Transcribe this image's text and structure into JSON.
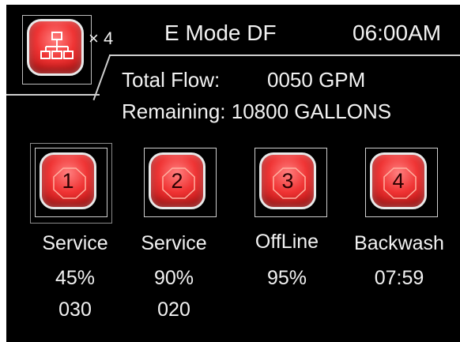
{
  "header": {
    "multiplier": "× 4",
    "mode": "E Mode DF",
    "time": "06:00AM"
  },
  "info": {
    "total_flow_label": "Total Flow:",
    "total_flow_value": "0050 GPM",
    "remaining": "Remaining: 10800 GALLONS"
  },
  "valves": [
    {
      "number": "1",
      "status": "Service",
      "line2": "45%",
      "line3": "030"
    },
    {
      "number": "2",
      "status": "Service",
      "line2": "90%",
      "line3": "020"
    },
    {
      "number": "3",
      "status": "OffLine",
      "line2": "95%",
      "line3": ""
    },
    {
      "number": "4",
      "status": "Backwash",
      "line2": "07:59",
      "line3": ""
    }
  ],
  "icons": {
    "hub": "network-tree-icon"
  },
  "colors": {
    "background": "#000000",
    "button_red": "#f03434",
    "text": "#f2f2f2"
  }
}
